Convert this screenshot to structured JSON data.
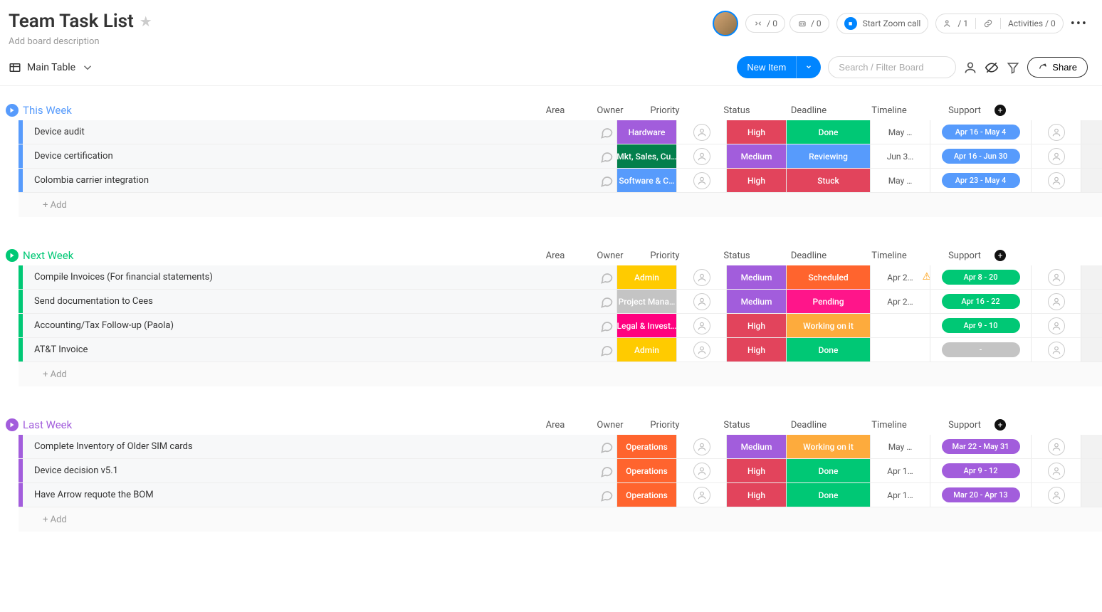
{
  "header": {
    "title": "Team Task List",
    "desc": "Add board description",
    "stat_integration": "/ 0",
    "stat_automation": "/ 0",
    "zoom_label": "Start Zoom call",
    "people_count": "/ 1",
    "activities_label": "Activities / 0"
  },
  "toolbar": {
    "view_label": "Main Table",
    "new_item": "New Item",
    "search_placeholder": "Search / Filter Board",
    "share_label": "Share"
  },
  "columns": {
    "area": "Area",
    "owner": "Owner",
    "priority": "Priority",
    "status": "Status",
    "deadline": "Deadline",
    "timeline": "Timeline",
    "support": "Support"
  },
  "add_row_label": "+ Add",
  "groups": [
    {
      "name": "This Week",
      "color": "#579bfc",
      "rows": [
        {
          "name": "Device audit",
          "area": "Hardware",
          "area_color": "c-purple",
          "priority": "High",
          "priority_color": "c-red",
          "status": "Done",
          "status_color": "c-green-dark",
          "deadline": "May …",
          "timeline": "Apr 16 - May 4",
          "timeline_color": "c-tlblue"
        },
        {
          "name": "Device certification",
          "area": "Mkt, Sales, Cu…",
          "area_color": "c-teal-dark",
          "priority": "Medium",
          "priority_color": "c-purple",
          "status": "Reviewing",
          "status_color": "c-blue",
          "deadline": "Jun 3…",
          "timeline": "Apr 16 - Jun 30",
          "timeline_color": "c-tlblue"
        },
        {
          "name": "Colombia carrier integration",
          "area": "Software & C…",
          "area_color": "c-blue",
          "priority": "High",
          "priority_color": "c-red",
          "status": "Stuck",
          "status_color": "c-red",
          "deadline": "May …",
          "timeline": "Apr 23 - May 4",
          "timeline_color": "c-tlblue"
        }
      ]
    },
    {
      "name": "Next Week",
      "color": "#00c875",
      "rows": [
        {
          "name": "Compile Invoices (For financial statements)",
          "area": "Admin",
          "area_color": "c-amber",
          "priority": "Medium",
          "priority_color": "c-purple",
          "status": "Scheduled",
          "status_color": "c-darkorange",
          "deadline": "Apr 2…",
          "warn": true,
          "timeline": "Apr 8 - 20",
          "timeline_color": "c-tlgreen"
        },
        {
          "name": "Send documentation to Cees",
          "area": "Project Mana…",
          "area_color": "c-gray",
          "priority": "Medium",
          "priority_color": "c-purple",
          "status": "Pending",
          "status_color": "c-hotpink",
          "deadline": "Apr 2…",
          "timeline": "Apr 16 - 22",
          "timeline_color": "c-tlgreen"
        },
        {
          "name": "Accounting/Tax Follow-up (Paola)",
          "area": "Legal & Invest…",
          "area_color": "c-magenta",
          "priority": "High",
          "priority_color": "c-red",
          "status": "Working on it",
          "status_color": "c-orange",
          "deadline": "",
          "timeline": "Apr 9 - 10",
          "timeline_color": "c-tlgreen"
        },
        {
          "name": "AT&T Invoice",
          "area": "Admin",
          "area_color": "c-amber",
          "priority": "High",
          "priority_color": "c-red",
          "status": "Done",
          "status_color": "c-green-dark",
          "deadline": "",
          "timeline": "-",
          "timeline_color": "c-tlgray"
        }
      ]
    },
    {
      "name": "Last Week",
      "color": "#a25ddc",
      "rows": [
        {
          "name": "Complete Inventory of Older SIM cards",
          "area": "Operations",
          "area_color": "c-darkorange",
          "priority": "Medium",
          "priority_color": "c-purple",
          "status": "Working on it",
          "status_color": "c-orange",
          "deadline": "May …",
          "timeline": "Mar 22 - May 31",
          "timeline_color": "c-tlpurple"
        },
        {
          "name": "Device decision v5.1",
          "area": "Operations",
          "area_color": "c-darkorange",
          "priority": "High",
          "priority_color": "c-red",
          "status": "Done",
          "status_color": "c-green-dark",
          "deadline": "Apr 1…",
          "timeline": "Apr 9 - 12",
          "timeline_color": "c-tlpurple"
        },
        {
          "name": "Have Arrow requote the BOM",
          "area": "Operations",
          "area_color": "c-darkorange",
          "priority": "High",
          "priority_color": "c-red",
          "status": "Done",
          "status_color": "c-green-dark",
          "deadline": "Apr 1…",
          "timeline": "Mar 20 - Apr 13",
          "timeline_color": "c-tlpurple"
        }
      ]
    }
  ]
}
